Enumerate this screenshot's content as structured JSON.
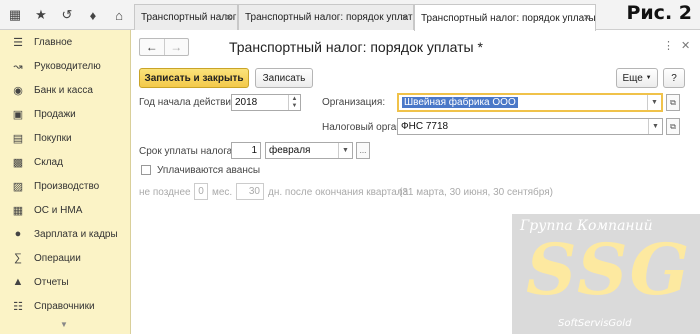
{
  "topbar": {
    "icons": [
      "grid-icon",
      "star-icon",
      "history-icon",
      "bell-icon",
      "home-icon"
    ],
    "tabs": [
      {
        "label": "Транспортный налог",
        "close": "×"
      },
      {
        "label": "Транспортный налог: порядок уплаты",
        "close": "×"
      },
      {
        "label": "Транспортный налог: порядок уплаты *",
        "close": "×"
      }
    ],
    "figure_label": "Рис. 2"
  },
  "sidebar": {
    "items": [
      {
        "label": "Главное",
        "icon": "menu-icon"
      },
      {
        "label": "Руководителю",
        "icon": "trend-icon"
      },
      {
        "label": "Банк и касса",
        "icon": "coin-icon"
      },
      {
        "label": "Продажи",
        "icon": "cart-icon"
      },
      {
        "label": "Покупки",
        "icon": "basket-icon"
      },
      {
        "label": "Склад",
        "icon": "warehouse-icon"
      },
      {
        "label": "Производство",
        "icon": "factory-icon"
      },
      {
        "label": "ОС и НМА",
        "icon": "assets-icon"
      },
      {
        "label": "Зарплата и кадры",
        "icon": "people-icon"
      },
      {
        "label": "Операции",
        "icon": "operations-icon"
      },
      {
        "label": "Отчеты",
        "icon": "reports-icon"
      },
      {
        "label": "Справочники",
        "icon": "catalog-icon"
      }
    ]
  },
  "form": {
    "title": "Транспортный налог: порядок уплаты *",
    "buttons": {
      "save_close": "Записать и закрыть",
      "save": "Записать",
      "more": "Еще"
    },
    "year_label": "Год начала действия:",
    "year_value": "2018",
    "org_label": "Организация:",
    "org_value": "Швейная фабрика ООО",
    "tax_office_label": "Налоговый орган:",
    "tax_office_value": "ФНС 7718",
    "deadline_label": "Срок уплаты налога:",
    "deadline_day": "1",
    "deadline_month": "февраля",
    "advance_label": "Уплачиваются авансы",
    "not_later_label": "не позднее",
    "months_value": "0",
    "months_label": "мес.",
    "days_value": "30",
    "days_label": "дн. после окончания квартала",
    "hint": "(31 марта, 30 июня, 30 сентября)"
  },
  "watermark": {
    "top": "Группа Компаний",
    "big": "SSG",
    "bottom": "SoftServisGold"
  },
  "colors": {
    "sidebar_bg": "#fbf3c6",
    "primary_btn": "#f3c94a",
    "selection": "#4a78c8"
  }
}
